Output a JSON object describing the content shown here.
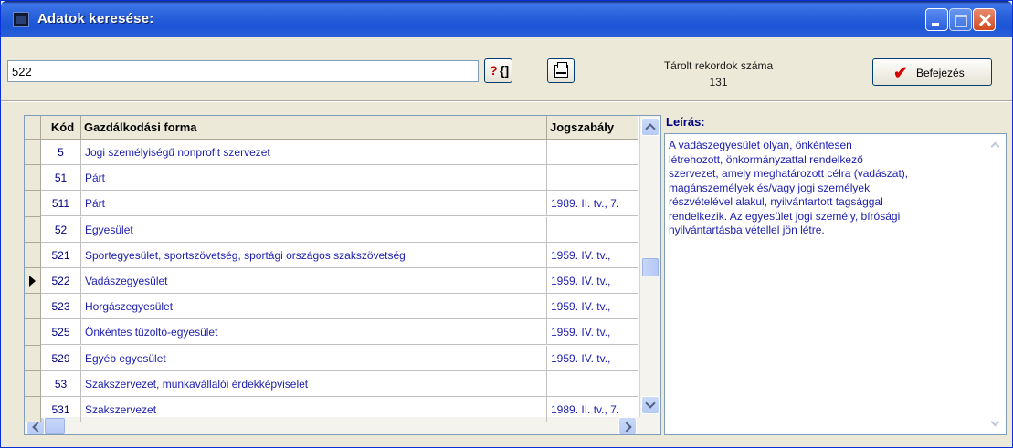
{
  "window": {
    "title": "Adatok keresése:"
  },
  "search": {
    "value": "522"
  },
  "toolbar": {
    "help_q": "?",
    "help_bracket": "{]",
    "records_label": "Tárolt rekordok száma",
    "records_count": "131",
    "finish_label": "Befejezés",
    "finish_check": "✔"
  },
  "grid": {
    "columns": [
      "Kód",
      "Gazdálkodási forma",
      "Jogszabály"
    ],
    "rows": [
      {
        "code": "5",
        "form": "Jogi személyiségű nonprofit szervezet",
        "law": ""
      },
      {
        "code": "51",
        "form": "Párt",
        "law": ""
      },
      {
        "code": "511",
        "form": "Párt",
        "law": "1989. II. tv., 7."
      },
      {
        "code": "52",
        "form": "Egyesület",
        "law": ""
      },
      {
        "code": "521",
        "form": "Sportegyesület, sportszövetség, sportági országos szakszövetség",
        "law": "1959. IV. tv.,"
      },
      {
        "code": "522",
        "form": "Vadászegyesület",
        "law": "1959. IV. tv.,"
      },
      {
        "code": "523",
        "form": "Horgászegyesület",
        "law": "1959. IV. tv.,"
      },
      {
        "code": "525",
        "form": "Önkéntes tűzoltó-egyesület",
        "law": "1959. IV. tv.,"
      },
      {
        "code": "529",
        "form": "Egyéb egyesület",
        "law": "1959. IV. tv.,"
      },
      {
        "code": "53",
        "form": "Szakszervezet, munkavállalói érdekképviselet",
        "law": ""
      },
      {
        "code": "531",
        "form": "Szakszervezet",
        "law": "1989. II. tv., 7."
      }
    ],
    "selected_code": "522"
  },
  "description": {
    "label": "Leírás:",
    "lines": [
      "A vadászegyesület olyan, önkéntesen",
      "létrehozott, önkormányzattal rendelkező",
      "szervezet, amely meghatározott célra (vadászat),",
      "magánszemélyek és/vagy jogi személyek",
      "részvételével alakul, nyilvántartott tagsággal",
      "rendelkezik. Az egyesület jogi személy, bírósági",
      "nyilvántartásba vétellel jön létre."
    ]
  }
}
